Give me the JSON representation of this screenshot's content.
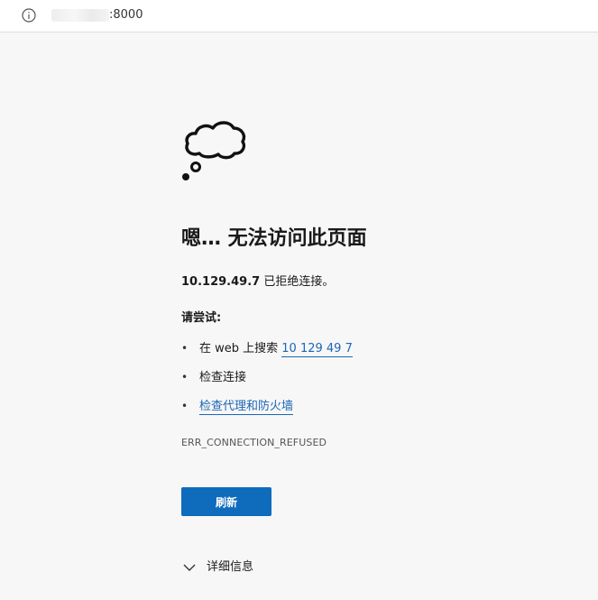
{
  "addressbar": {
    "url_visible_suffix": ":8000",
    "info_icon": "info-icon"
  },
  "error_page": {
    "icon": "cloud-icon",
    "title": "嗯… 无法访问此页面",
    "host": "10.129.49.7",
    "refused_text": " 已拒绝连接。",
    "try_label": "请尝试:",
    "suggestions": [
      {
        "prefix": "在 web 上搜索 ",
        "link": "10 129 49 7"
      },
      {
        "text": "检查连接"
      },
      {
        "link": "检查代理和防火墙"
      }
    ],
    "error_code": "ERR_CONNECTION_REFUSED",
    "refresh_label": "刷新",
    "details_label": "详细信息"
  },
  "colors": {
    "accent": "#0f6cbd",
    "link": "#1b66b6",
    "background": "#f7f7f7"
  }
}
